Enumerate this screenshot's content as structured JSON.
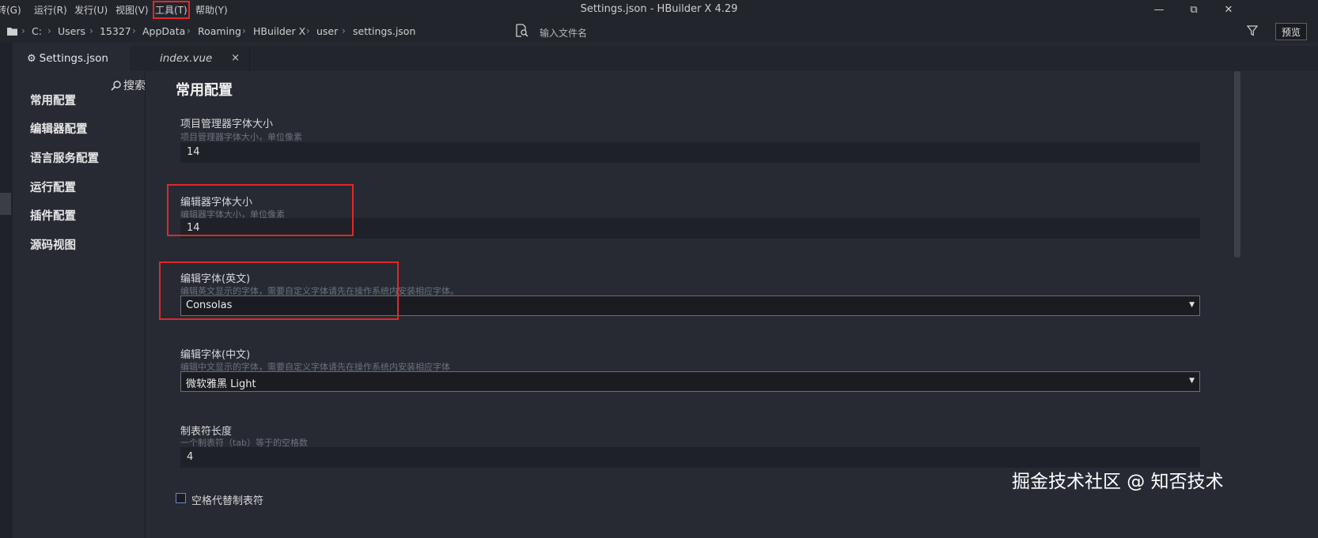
{
  "menu": {
    "items": [
      "转(G)",
      "运行(R)",
      "发行(U)",
      "视图(V)",
      "工具(T)",
      "帮助(Y)"
    ],
    "highlighted_index": 4,
    "window_title": "Settings.json - HBuilder X 4.29"
  },
  "breadcrumb": {
    "parts": [
      "C:",
      "Users",
      "15327",
      "AppData",
      "Roaming",
      "HBuilder X",
      "user",
      "settings.json"
    ],
    "file_search_placeholder": "输入文件名",
    "preview_label": "预览"
  },
  "tabs": [
    {
      "label": "Settings.json",
      "icon": "gear-icon",
      "active": true
    },
    {
      "label": "index.vue",
      "close": "×",
      "active": false
    }
  ],
  "sidebar": {
    "search_label": "搜索",
    "items": [
      "常用配置",
      "编辑器配置",
      "语言服务配置",
      "运行配置",
      "插件配置",
      "源码视图"
    ]
  },
  "main": {
    "title": "常用配置",
    "settings": [
      {
        "label": "项目管理器字体大小",
        "desc": "项目管理器字体大小，单位像素",
        "value": "14"
      },
      {
        "label": "编辑器字体大小",
        "desc": "编辑器字体大小，单位像素",
        "value": "14"
      },
      {
        "label": "编辑字体(英文)",
        "desc": "编辑英文显示的字体，需要自定义字体请先在操作系统内安装相应字体。",
        "value": "Consolas"
      },
      {
        "label": "编辑字体(中文)",
        "desc": "编辑中文显示的字体，需要自定义字体请先在操作系统内安装相应字体",
        "value": "微软雅黑 Light"
      },
      {
        "label": "制表符长度",
        "desc": "一个制表符（tab）等于的空格数",
        "value": "4"
      }
    ],
    "checkbox_label": "空格代替制表符"
  },
  "watermark": "掘金技术社区 @ 知否技术",
  "colors": {
    "highlight": "#e0282a",
    "background": "#272a33"
  }
}
